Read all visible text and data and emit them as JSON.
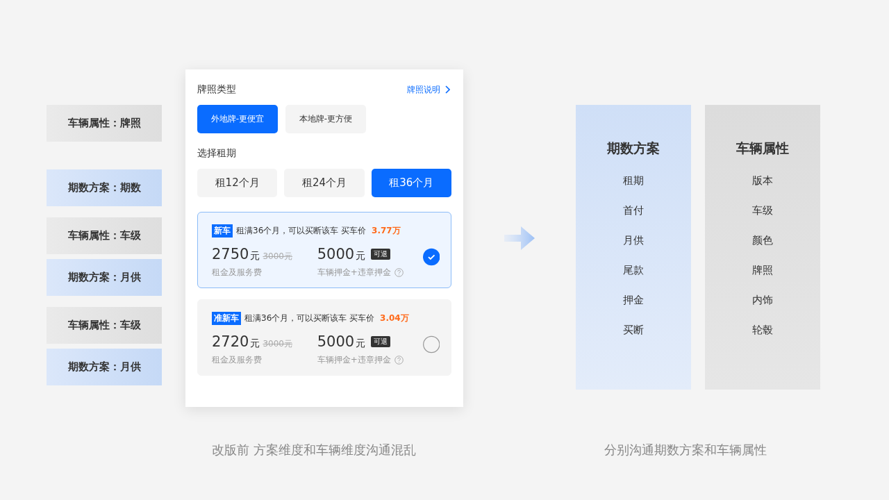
{
  "left_tags": [
    [
      {
        "kind": "vehicle",
        "text": "车辆属性：牌照"
      }
    ],
    [
      {
        "kind": "plan",
        "text": "期数方案：期数"
      }
    ],
    [
      {
        "kind": "vehicle",
        "text": "车辆属性：车级"
      },
      {
        "kind": "plan",
        "text": "期数方案：月供"
      }
    ],
    [
      {
        "kind": "vehicle",
        "text": "车辆属性：车级"
      },
      {
        "kind": "plan",
        "text": "期数方案：月供"
      }
    ]
  ],
  "card": {
    "plate_title": "牌照类型",
    "plate_link": "牌照说明",
    "plates": [
      {
        "label": "外地牌-更便宜",
        "selected": true
      },
      {
        "label": "本地牌-更方便",
        "selected": false
      }
    ],
    "term_title": "选择租期",
    "terms": [
      {
        "label": "租12个月",
        "selected": false
      },
      {
        "label": "租24个月",
        "selected": false
      },
      {
        "label": "租36个月",
        "selected": true
      }
    ],
    "options": [
      {
        "tag": "新车",
        "desc": "租满36个月，可以买断该车 买车价",
        "buy_price": "3.77万",
        "rent": "2750",
        "rent_unit": "元",
        "rent_original": "3000元",
        "rent_label": "租金及服务费",
        "deposit": "5000",
        "deposit_unit": "元",
        "deposit_badge": "可退",
        "deposit_label": "车辆押金+违章押金",
        "selected": true
      },
      {
        "tag": "准新车",
        "desc": "租满36个月，可以买断该车 买车价",
        "buy_price": "3.04万",
        "rent": "2720",
        "rent_unit": "元",
        "rent_original": "3000元",
        "rent_label": "租金及服务费",
        "deposit": "5000",
        "deposit_unit": "元",
        "deposit_badge": "可退",
        "deposit_label": "车辆押金+违章押金",
        "selected": false
      }
    ]
  },
  "columns": [
    {
      "kind": "plan",
      "title": "期数方案",
      "items": [
        "租期",
        "首付",
        "月供",
        "尾款",
        "押金",
        "买断"
      ]
    },
    {
      "kind": "vehicle",
      "title": "车辆属性",
      "items": [
        "版本",
        "车级",
        "颜色",
        "牌照",
        "内饰",
        "轮毂"
      ]
    }
  ],
  "captions": [
    "改版前 方案维度和车辆维度沟通混乱",
    "分别沟通期数方案和车辆属性"
  ]
}
